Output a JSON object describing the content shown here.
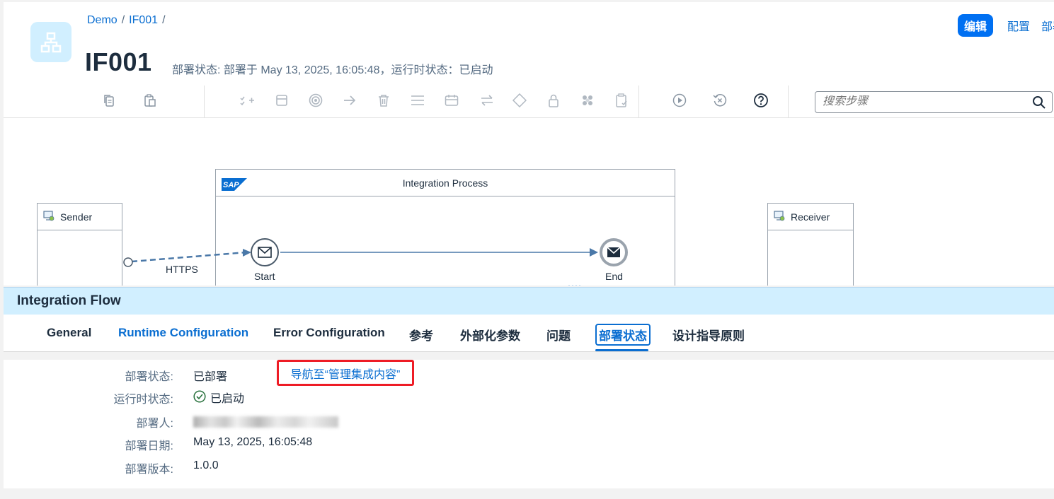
{
  "breadcrumb": {
    "items": [
      "Demo",
      "IF001"
    ],
    "separator": "/"
  },
  "header": {
    "title": "IF001",
    "subtitle": "部署状态: 部署于 May 13, 2025, 16:05:48，运行时状态：已启动",
    "edit_label": "编辑",
    "config_label": "配置",
    "deploy_label": "部署"
  },
  "toolbar": {
    "icons": [
      "copy-icon",
      "paste-icon",
      "add-step-icon",
      "participant-icon",
      "target-icon",
      "arrow-icon",
      "delete-icon",
      "menu-icon",
      "calendar-icon",
      "transfer-icon",
      "gateway-icon",
      "lock-icon",
      "package-icon",
      "clipboard-check-icon",
      "simulate-icon",
      "reset-icon",
      "help-icon"
    ],
    "search_placeholder": "搜索步骤"
  },
  "diagram": {
    "sender_label": "Sender",
    "receiver_label": "Receiver",
    "process_label": "Integration Process",
    "start_label": "Start",
    "end_label": "End",
    "adapter_label": "HTTPS",
    "sap_logo_text": "SAP"
  },
  "panel": {
    "title": "Integration Flow",
    "tabs": [
      "General",
      "Runtime Configuration",
      "Error Configuration",
      "参考",
      "外部化参数",
      "问题",
      "部署状态",
      "设计指导原则"
    ],
    "active_tab": "部署状态"
  },
  "deploy": {
    "status_label": "部署状态:",
    "status_value": "已部署",
    "nav_link": "导航至“管理集成内容”",
    "runtime_label": "运行时状态:",
    "runtime_value": "已启动",
    "deployer_label": "部署人:",
    "date_label": "部署日期:",
    "date_value": "May 13, 2025, 16:05:48",
    "version_label": "部署版本:",
    "version_value": "1.0.0"
  },
  "colors": {
    "accent": "#0a6ed1",
    "emphasized_button": "#0070f2",
    "panel_header": "#d1efff",
    "success": "#256f3a",
    "highlight_box": "#ee1c25"
  }
}
